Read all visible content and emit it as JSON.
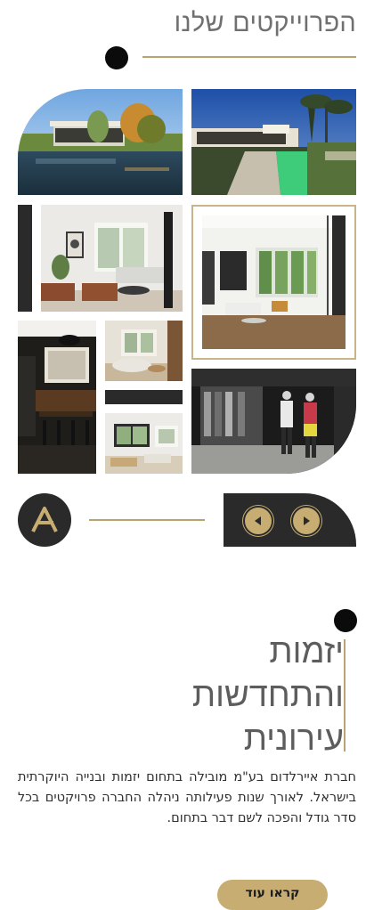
{
  "projects": {
    "title": "הפרוייקטים שלנו"
  },
  "gallery": {
    "items": [
      {
        "name": "project-pool-villa"
      },
      {
        "name": "project-garden-pool"
      },
      {
        "name": "project-living-room"
      },
      {
        "name": "project-framed-living-room"
      },
      {
        "name": "project-dark-kitchen"
      },
      {
        "name": "project-lounge"
      },
      {
        "name": "project-dining"
      },
      {
        "name": "project-fashion-store"
      }
    ]
  },
  "nav": {
    "logo_icon": "a-logo-icon",
    "prev_icon": "chevron-left-icon",
    "next_icon": "chevron-right-icon"
  },
  "about": {
    "headline_lines": [
      "יזמות",
      "והתחדשות",
      "עירונית"
    ],
    "paragraph": "חברת איירלדום בע\"מ מובילה בתחום יזמות ובנייה היוקרתית בישראל. לאורך שנות פעילותה ניהלה החברה פרויקטים בכל סדר גודל והפכה לשם דבר בתחום.",
    "cta_label": "קראו עוד"
  },
  "colors": {
    "accent_gold": "#c7ad72",
    "dark": "#2a2a2a",
    "text_gray": "#707070"
  }
}
